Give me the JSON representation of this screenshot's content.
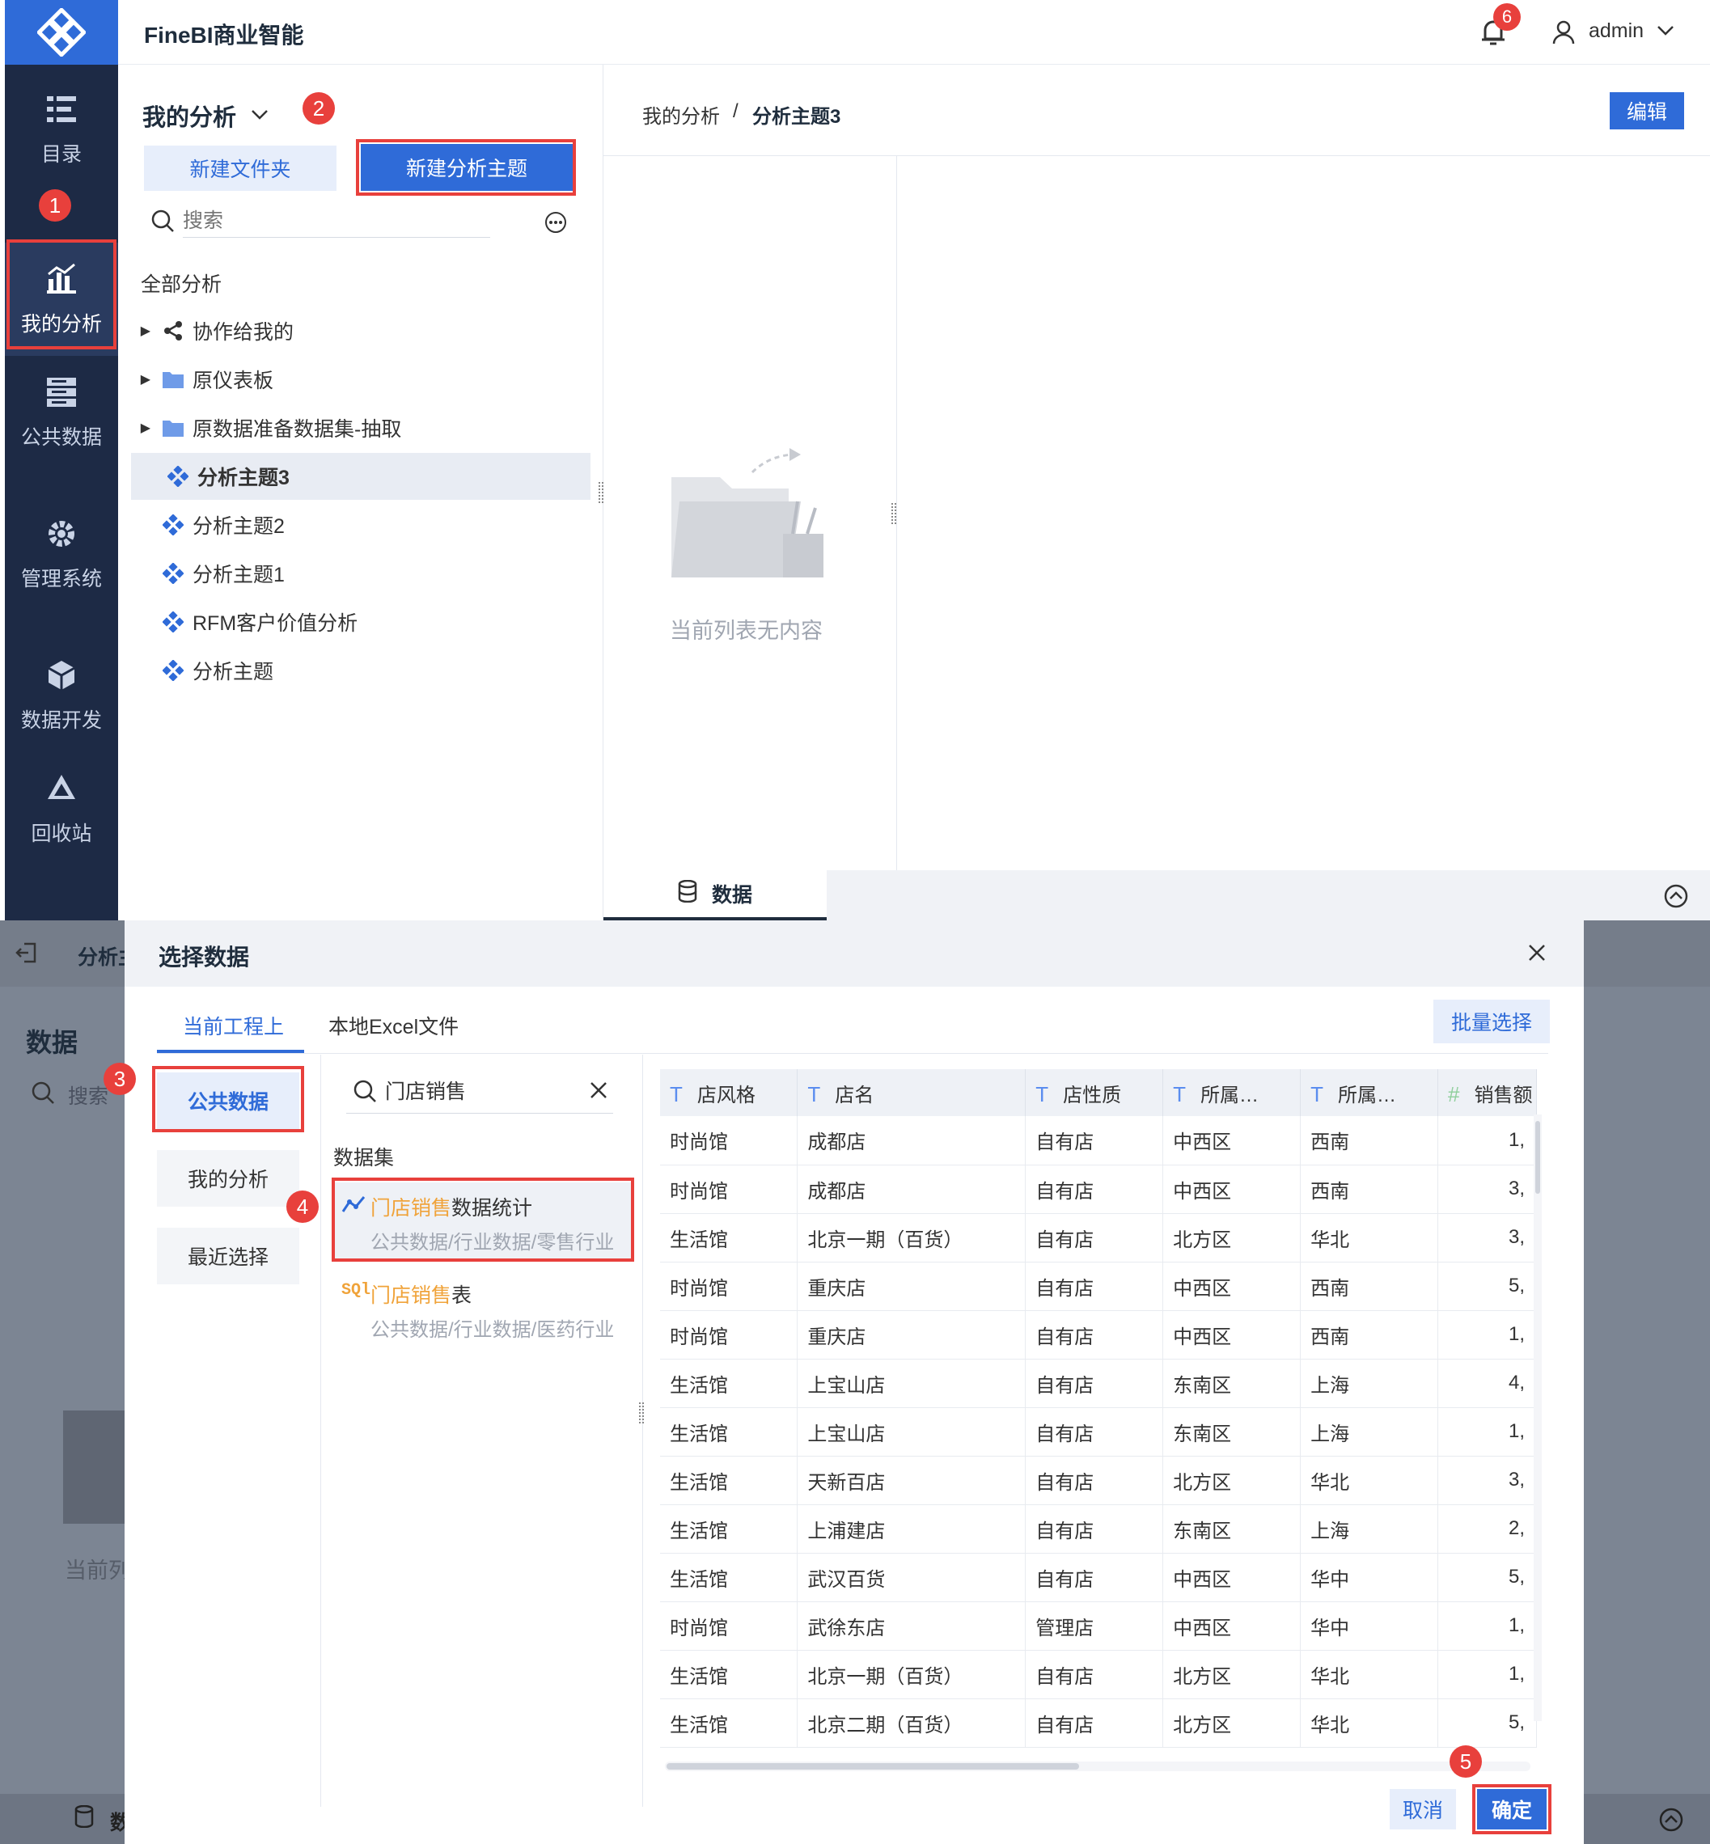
{
  "app": {
    "title": "FineBI商业智能",
    "notification_count": "6",
    "user": "admin"
  },
  "nav": [
    {
      "label": "目录",
      "icon": "catalog-icon"
    },
    {
      "label": "我的分析",
      "icon": "analysis-icon"
    },
    {
      "label": "公共数据",
      "icon": "public-data-icon"
    },
    {
      "label": "管理系统",
      "icon": "gear-icon"
    },
    {
      "label": "数据开发",
      "icon": "cube-icon"
    },
    {
      "label": "回收站",
      "icon": "recycle-icon"
    }
  ],
  "steps": [
    "1",
    "2",
    "3",
    "4",
    "5"
  ],
  "panel": {
    "title": "我的分析",
    "new_folder": "新建文件夹",
    "new_topic": "新建分析主题",
    "search_placeholder": "搜索",
    "all_label": "全部分析",
    "tree": [
      {
        "label": "协作给我的",
        "type": "share",
        "expandable": true
      },
      {
        "label": "原仪表板",
        "type": "folder",
        "expandable": true
      },
      {
        "label": "原数据准备数据集-抽取",
        "type": "folder",
        "expandable": true
      },
      {
        "label": "分析主题3",
        "type": "topic",
        "selected": true
      },
      {
        "label": "分析主题2",
        "type": "topic"
      },
      {
        "label": "分析主题1",
        "type": "topic"
      },
      {
        "label": "RFM客户价值分析",
        "type": "topic"
      },
      {
        "label": "分析主题",
        "type": "topic"
      }
    ]
  },
  "main": {
    "breadcrumb_root": "我的分析",
    "breadcrumb_sep": "/",
    "breadcrumb_current": "分析主题3",
    "edit": "编辑",
    "empty_text": "当前列表无内容",
    "bottom_tab": "数据"
  },
  "background": {
    "tab_label": "分析主",
    "data_title": "数据",
    "search_placeholder": "搜索",
    "empty_text": "当前列",
    "bottom_tab": "数"
  },
  "dialog": {
    "title": "选择数据",
    "tab_current": "当前工程上",
    "tab_excel": "本地Excel文件",
    "batch_select": "批量选择",
    "side": [
      "公共数据",
      "我的分析",
      "最近选择"
    ],
    "search_value": "门店销售",
    "list_title": "数据集",
    "results": [
      {
        "highlight": "门店销售",
        "rest": "数据统计",
        "path": "公共数据/行业数据/零售行业",
        "icon": "dataset-line-icon"
      },
      {
        "highlight": "门店销售",
        "rest": "表",
        "path": "公共数据/行业数据/医药行业",
        "icon": "sql-icon"
      }
    ],
    "columns": [
      {
        "label": "店风格",
        "type": "T"
      },
      {
        "label": "店名",
        "type": "T"
      },
      {
        "label": "店性质",
        "type": "T"
      },
      {
        "label": "所属…",
        "type": "T"
      },
      {
        "label": "所属…",
        "type": "T"
      },
      {
        "label": "销售额",
        "type": "#"
      }
    ],
    "rows": [
      [
        "时尚馆",
        "成都店",
        "自有店",
        "中西区",
        "西南",
        "1,"
      ],
      [
        "时尚馆",
        "成都店",
        "自有店",
        "中西区",
        "西南",
        "3,"
      ],
      [
        "生活馆",
        "北京一期（百货）",
        "自有店",
        "北方区",
        "华北",
        "3,"
      ],
      [
        "时尚馆",
        "重庆店",
        "自有店",
        "中西区",
        "西南",
        "5,"
      ],
      [
        "时尚馆",
        "重庆店",
        "自有店",
        "中西区",
        "西南",
        "1,"
      ],
      [
        "生活馆",
        "上宝山店",
        "自有店",
        "东南区",
        "上海",
        "4,"
      ],
      [
        "生活馆",
        "上宝山店",
        "自有店",
        "东南区",
        "上海",
        "1,"
      ],
      [
        "生活馆",
        "天新百店",
        "自有店",
        "北方区",
        "华北",
        "3,"
      ],
      [
        "生活馆",
        "上浦建店",
        "自有店",
        "东南区",
        "上海",
        "2,"
      ],
      [
        "生活馆",
        "武汉百货",
        "自有店",
        "中西区",
        "华中",
        "5,"
      ],
      [
        "时尚馆",
        "武徐东店",
        "管理店",
        "中西区",
        "华中",
        "1,"
      ],
      [
        "生活馆",
        "北京一期（百货）",
        "自有店",
        "北方区",
        "华北",
        "1,"
      ],
      [
        "生活馆",
        "北京二期（百货）",
        "自有店",
        "北方区",
        "华北",
        "5,"
      ]
    ],
    "cancel": "取消",
    "confirm": "确定"
  },
  "colors": {
    "accent": "#2f6bd8",
    "sidebar": "#1d2a45",
    "highlight": "#e8403c",
    "match": "#f0a33a"
  }
}
